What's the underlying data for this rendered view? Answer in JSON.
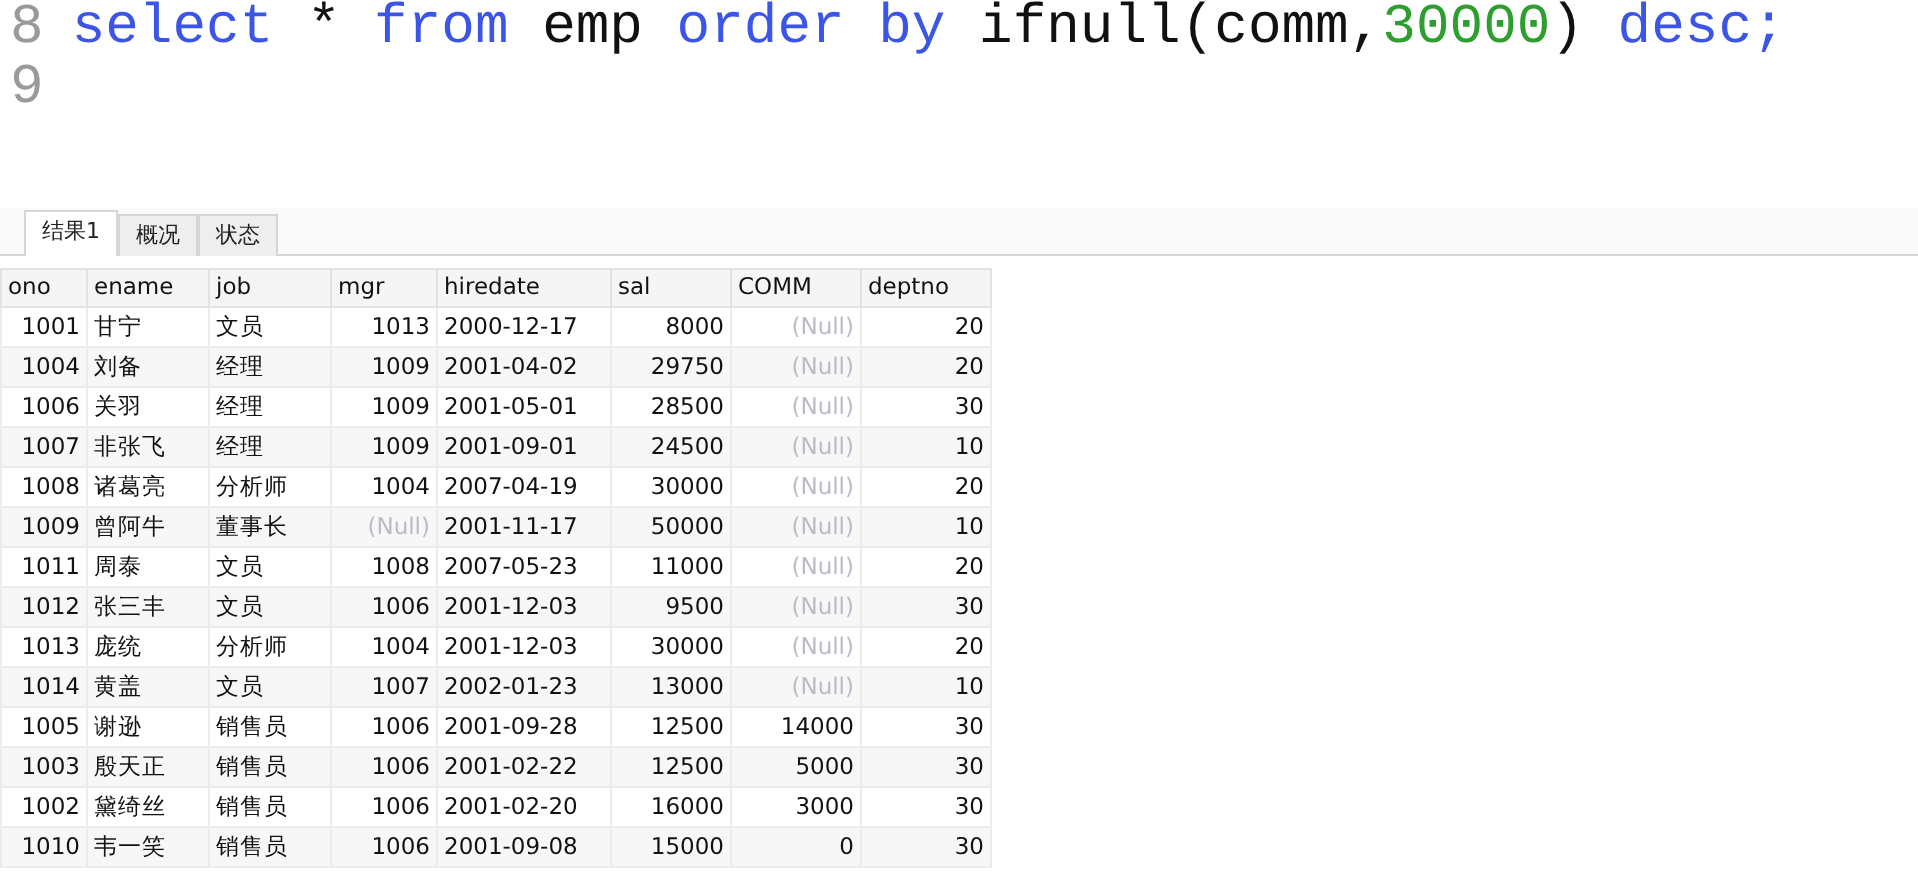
{
  "editor": {
    "lines": [
      {
        "number": "8",
        "tokens": [
          {
            "text": "select ",
            "kind": "keyword"
          },
          {
            "text": "* ",
            "kind": "plain"
          },
          {
            "text": "from ",
            "kind": "keyword"
          },
          {
            "text": "emp ",
            "kind": "plain"
          },
          {
            "text": "order by ",
            "kind": "keyword"
          },
          {
            "text": "ifnull(comm,",
            "kind": "plain"
          },
          {
            "text": "30000",
            "kind": "number"
          },
          {
            "text": ") ",
            "kind": "plain"
          },
          {
            "text": "desc;",
            "kind": "keyword"
          }
        ]
      },
      {
        "number": "9"
      }
    ]
  },
  "tabs": [
    {
      "label": "结果1",
      "selected": true
    },
    {
      "label": "概况",
      "selected": false
    },
    {
      "label": "状态",
      "selected": false
    }
  ],
  "table": {
    "columns": [
      {
        "label": "ono",
        "kind": "number"
      },
      {
        "label": "ename",
        "kind": "text"
      },
      {
        "label": "job",
        "kind": "text"
      },
      {
        "label": "mgr",
        "kind": "number"
      },
      {
        "label": "hiredate",
        "kind": "text"
      },
      {
        "label": "sal",
        "kind": "number"
      },
      {
        "label": "COMM",
        "kind": "number"
      },
      {
        "label": "deptno",
        "kind": "number"
      }
    ],
    "rows": [
      [
        "1001",
        "甘宁",
        "文员",
        "1013",
        "2000-12-17",
        "8000",
        {
          "text": "(Null)",
          "kind": "null"
        },
        "20"
      ],
      [
        "1004",
        "刘备",
        "经理",
        "1009",
        "2001-04-02",
        "29750",
        {
          "text": "(Null)",
          "kind": "null"
        },
        "20"
      ],
      [
        "1006",
        "关羽",
        "经理",
        "1009",
        "2001-05-01",
        "28500",
        {
          "text": "(Null)",
          "kind": "null"
        },
        "30"
      ],
      [
        "1007",
        "非张飞",
        "经理",
        "1009",
        "2001-09-01",
        "24500",
        {
          "text": "(Null)",
          "kind": "null"
        },
        "10"
      ],
      [
        "1008",
        "诸葛亮",
        "分析师",
        "1004",
        "2007-04-19",
        "30000",
        {
          "text": "(Null)",
          "kind": "null"
        },
        "20"
      ],
      [
        "1009",
        "曾阿牛",
        "董事长",
        {
          "text": "(Null)",
          "kind": "null"
        },
        "2001-11-17",
        "50000",
        {
          "text": "(Null)",
          "kind": "null"
        },
        "10"
      ],
      [
        "1011",
        "周泰",
        "文员",
        "1008",
        "2007-05-23",
        "11000",
        {
          "text": "(Null)",
          "kind": "null"
        },
        "20"
      ],
      [
        "1012",
        "张三丰",
        "文员",
        "1006",
        "2001-12-03",
        "9500",
        {
          "text": "(Null)",
          "kind": "null"
        },
        "30"
      ],
      [
        "1013",
        "庞统",
        "分析师",
        "1004",
        "2001-12-03",
        "30000",
        {
          "text": "(Null)",
          "kind": "null"
        },
        "20"
      ],
      [
        "1014",
        "黄盖",
        "文员",
        "1007",
        "2002-01-23",
        "13000",
        {
          "text": "(Null)",
          "kind": "null"
        },
        "10"
      ],
      [
        "1005",
        "谢逊",
        "销售员",
        "1006",
        "2001-09-28",
        "12500",
        "14000",
        "30"
      ],
      [
        "1003",
        "殷天正",
        "销售员",
        "1006",
        "2001-02-22",
        "12500",
        "5000",
        "30"
      ],
      [
        "1002",
        "黛绮丝",
        "销售员",
        "1006",
        "2001-02-20",
        "16000",
        "3000",
        "30"
      ],
      [
        "1010",
        "韦一笑",
        "销售员",
        "1006",
        "2001-09-08",
        "15000",
        "0",
        "30"
      ]
    ]
  }
}
